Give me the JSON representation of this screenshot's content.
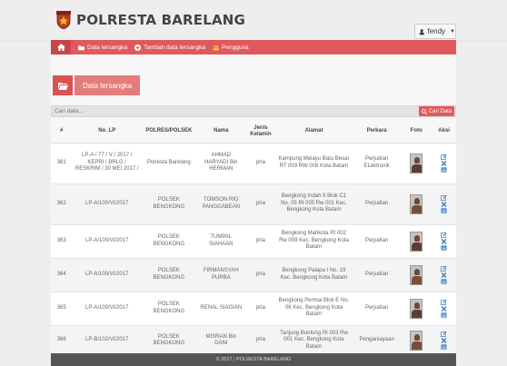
{
  "app": {
    "title": "POLRESTA BARELANG"
  },
  "user": {
    "name": "fendy"
  },
  "nav": {
    "items": [
      {
        "label": "Data tersangka"
      },
      {
        "label": "Tambah data tersangka"
      },
      {
        "label": "Pengguna"
      }
    ]
  },
  "panel": {
    "title": "Data tersangka"
  },
  "search": {
    "placeholder": "Cari data...",
    "button_label": "Cari Data"
  },
  "table": {
    "headers": [
      "#",
      "No. LP",
      "POLRES/POLSEK",
      "Nama",
      "Jenis Kelamin",
      "Alamat",
      "Perkara",
      "Foto",
      "Aksi"
    ],
    "rows": [
      {
        "no": "361",
        "lp": "LP-A / 77 / V / 2017 / KEPRI / BRLG / RESKRIM / 30 MEI 2017 /",
        "polsek": "Polresta Barelang",
        "nama": "AHMAD HARYADI Bin HERMAN",
        "jk": "pria",
        "alamat": "Kampung Melayu Batu Besar RT 003 RW 008 Kota Batam",
        "perkara": "Perjudian ELektronik"
      },
      {
        "no": "362",
        "lp": "LP-A/100/VI/2017",
        "polsek": "POLSEK BENGKONG",
        "nama": "TOMSON RIO PANGGABEAN",
        "jk": "pria",
        "alamat": "Bengkong Indah II Blok C1 No. 05 Rt 005 Rw 001 Kec. Bengkong Kota Batam",
        "perkara": "Perjudian"
      },
      {
        "no": "363",
        "lp": "LP-A/100/VI/2017",
        "polsek": "POLSEK BENGKONG",
        "nama": "TUMPAL SIAHAAN",
        "jk": "pria",
        "alamat": "Bengkong Mahkota Rt 002 Rw 009 Kec. Bengkong Kota Batam",
        "perkara": "Perjudian"
      },
      {
        "no": "364",
        "lp": "LP-A/100/VI/2017",
        "polsek": "POLSEK BENGKONG",
        "nama": "FIRMANSYAH PURBA",
        "jk": "pria",
        "alamat": "Bengkong Palapa I No. 19 Kec. Bengkong Kota Batam",
        "perkara": "Perjudian"
      },
      {
        "no": "365",
        "lp": "LP-A/100/VI/2017",
        "polsek": "POLSEK BENGKONG",
        "nama": "RENAL SIAGIAN",
        "jk": "pria",
        "alamat": "Bengkong Permai Blok E No. 06 Kec. Bengkong Kota Batam",
        "perkara": "Perjudian"
      },
      {
        "no": "366",
        "lp": "LP-B/102/VI/2017",
        "polsek": "POLSEK BENGKONG",
        "nama": "MISRAN Bin DANI",
        "jk": "pria",
        "alamat": "Tanjung Buntung Rt 003 Rw 001 Kec. Bengkong Kota Batam",
        "perkara": "Penganiayaan"
      }
    ]
  },
  "footer": {
    "text": "© 2017 | POLRESTA BARELANG"
  },
  "colors": {
    "accent": "#e05a5d",
    "accent_dark": "#c84649",
    "panel_label": "#e57c7c",
    "footer": "#555555"
  },
  "icons": {
    "logo": "police-badge-icon",
    "user": "person-icon",
    "home": "home-icon",
    "nav": [
      "folder-icon",
      "plus-circle-icon",
      "users-icon"
    ],
    "search": "search-icon",
    "actions": [
      "edit-icon",
      "delete-icon",
      "print-icon"
    ]
  }
}
